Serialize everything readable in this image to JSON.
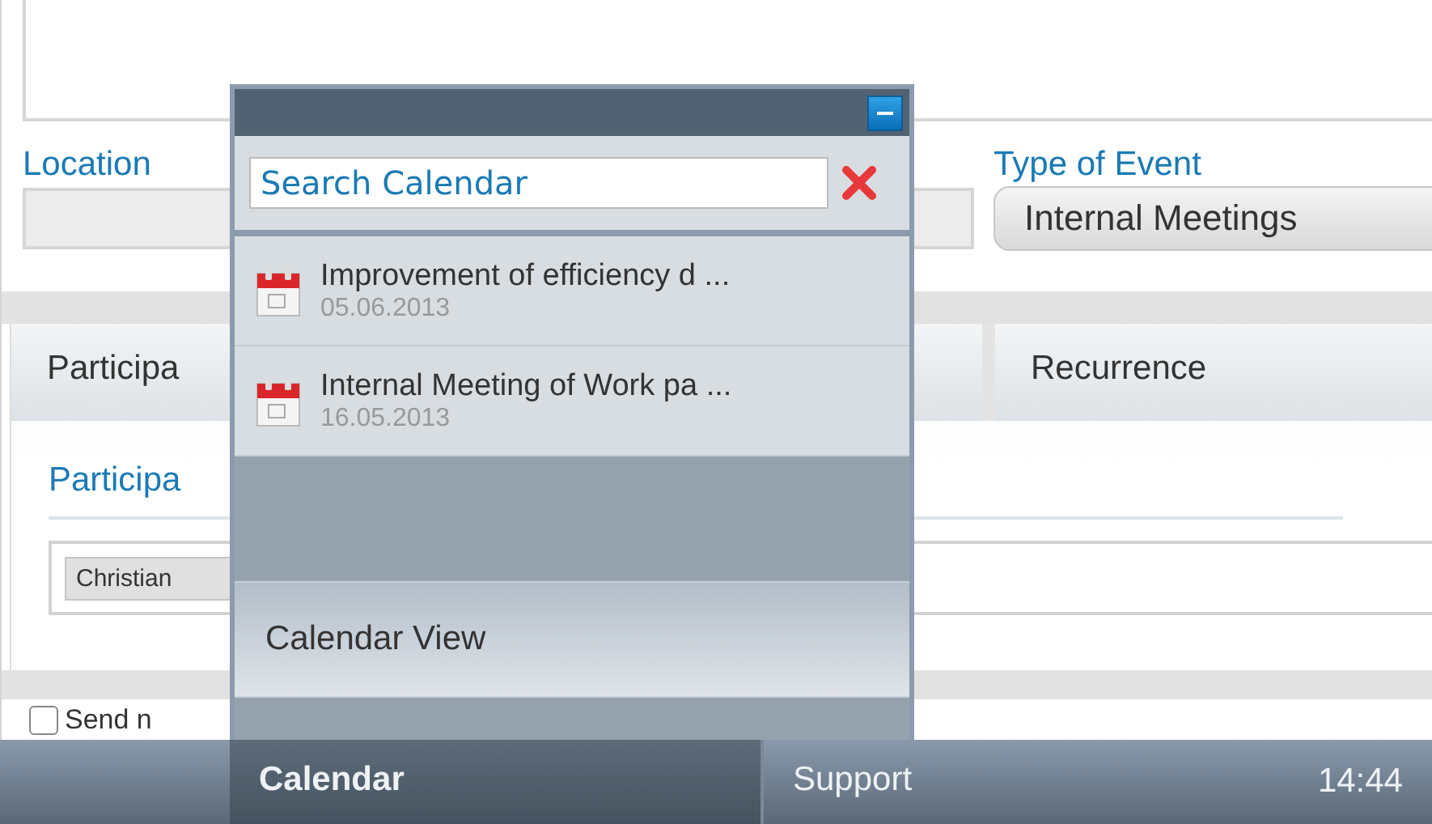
{
  "form": {
    "location": {
      "label": "Location"
    },
    "type_of_event": {
      "label": "Type of Event",
      "value": "Internal Meetings"
    },
    "tabs": [
      {
        "label": "Participa"
      },
      {
        "label": "Recurrence"
      }
    ],
    "participants": {
      "label": "Participa",
      "chips": [
        "Christian"
      ]
    },
    "notify": {
      "label": "Send n",
      "checked": false
    }
  },
  "popup": {
    "search": {
      "placeholder": "Search Calendar"
    },
    "results": [
      {
        "title": "Improvement of efficiency d ...",
        "date": "05.06.2013"
      },
      {
        "title": "Internal Meeting of Work pa ...",
        "date": "16.05.2013"
      }
    ],
    "calendar_view": "Calendar View"
  },
  "taskbar": {
    "items": [
      {
        "label": "Calendar",
        "selected": true
      },
      {
        "label": "Support",
        "selected": false
      }
    ],
    "time": "14:44"
  }
}
